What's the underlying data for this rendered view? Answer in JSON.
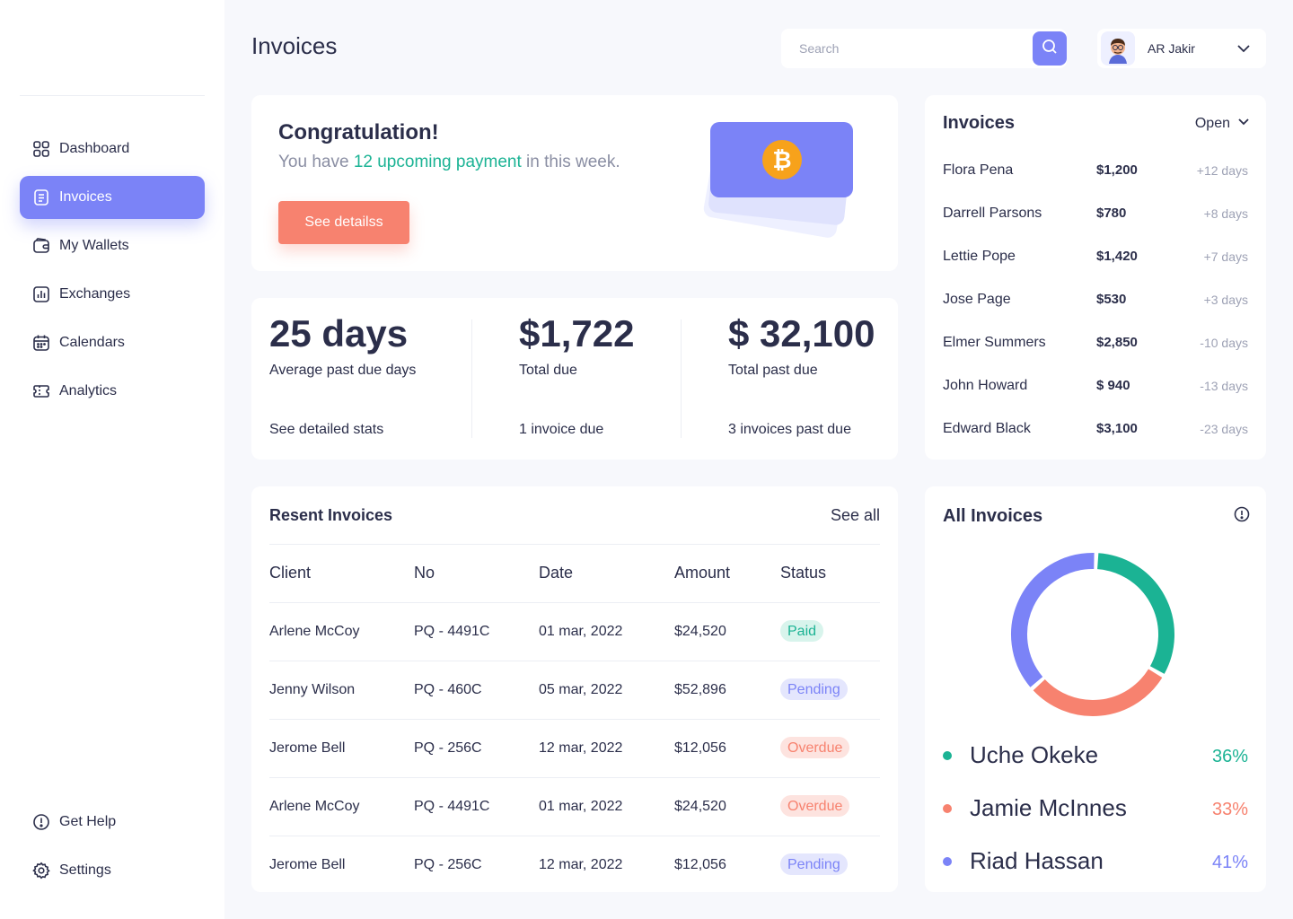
{
  "sidebar": {
    "items": [
      {
        "label": "Dashboard"
      },
      {
        "label": "Invoices"
      },
      {
        "label": "My Wallets"
      },
      {
        "label": "Exchanges"
      },
      {
        "label": "Calendars"
      },
      {
        "label": "Analytics"
      }
    ],
    "bottom": [
      {
        "label": "Get Help"
      },
      {
        "label": "Settings"
      }
    ]
  },
  "header": {
    "title": "Invoices",
    "search_placeholder": "Search",
    "user_name": "AR Jakir"
  },
  "congrats": {
    "title": "Congratulation!",
    "text_before": "You have ",
    "highlight": "12 upcoming payment",
    "text_after": " in this week.",
    "button": "See detailss"
  },
  "stats": [
    {
      "value": "25 days",
      "label": "Average past due days",
      "foot": "See detailed stats"
    },
    {
      "value": "$1,722",
      "label": "Total due",
      "foot": "1 invoice due"
    },
    {
      "value": "$ 32,100",
      "label": "Total past due",
      "foot": "3 invoices past due"
    }
  ],
  "invoices_panel": {
    "title": "Invoices",
    "filter": "Open",
    "rows": [
      {
        "name": "Flora Pena",
        "amount": "$1,200",
        "days": "+12 days"
      },
      {
        "name": "Darrell Parsons",
        "amount": "$780",
        "days": "+8 days"
      },
      {
        "name": "Lettie Pope",
        "amount": "$1,420",
        "days": "+7 days"
      },
      {
        "name": "Jose Page",
        "amount": "$530",
        "days": "+3 days"
      },
      {
        "name": "Elmer Summers",
        "amount": "$2,850",
        "days": "-10 days"
      },
      {
        "name": "John Howard",
        "amount": "$ 940",
        "days": "-13 days"
      },
      {
        "name": "Edward Black",
        "amount": "$3,100",
        "days": "-23 days"
      }
    ]
  },
  "recent": {
    "title": "Resent Invoices",
    "see_all": "See all",
    "columns": [
      "Client",
      "No",
      "Date",
      "Amount",
      "Status"
    ],
    "rows": [
      {
        "client": "Arlene McCoy",
        "no": "PQ - 4491C",
        "date": "01 mar, 2022",
        "amount": "$24,520",
        "status": "Paid",
        "kind": "paid"
      },
      {
        "client": "Jenny Wilson",
        "no": "PQ - 460C",
        "date": "05 mar, 2022",
        "amount": "$52,896",
        "status": "Pending",
        "kind": "pending"
      },
      {
        "client": "Jerome Bell",
        "no": "PQ - 256C",
        "date": "12 mar, 2022",
        "amount": "$12,056",
        "status": "Overdue",
        "kind": "overdue"
      },
      {
        "client": "Arlene McCoy",
        "no": "PQ - 4491C",
        "date": "01 mar, 2022",
        "amount": "$24,520",
        "status": "Overdue",
        "kind": "overdue"
      },
      {
        "client": "Jerome Bell",
        "no": "PQ - 256C",
        "date": "12 mar, 2022",
        "amount": "$12,056",
        "status": "Pending",
        "kind": "pending"
      }
    ]
  },
  "all_invoices": {
    "title": "All Invoices",
    "legend": [
      {
        "name": "Uche Okeke",
        "percent": "36%",
        "value": 36,
        "color": "#1bb394"
      },
      {
        "name": "Jamie McInnes",
        "percent": "33%",
        "value": 33,
        "color": "#f7826f"
      },
      {
        "name": "Riad Hassan",
        "percent": "41%",
        "value": 41,
        "color": "#7b83f7"
      }
    ]
  },
  "colors": {
    "accent": "#7b83f7",
    "green": "#1bb394",
    "coral": "#f7826f",
    "bitcoin": "#f7a21b"
  },
  "icons": [
    "grid-icon",
    "document-icon",
    "wallet-icon",
    "chart-icon",
    "calendar-icon",
    "ticket-icon",
    "help-icon",
    "gear-icon",
    "search-icon",
    "chevron-down-icon",
    "bitcoin-icon",
    "info-icon"
  ]
}
